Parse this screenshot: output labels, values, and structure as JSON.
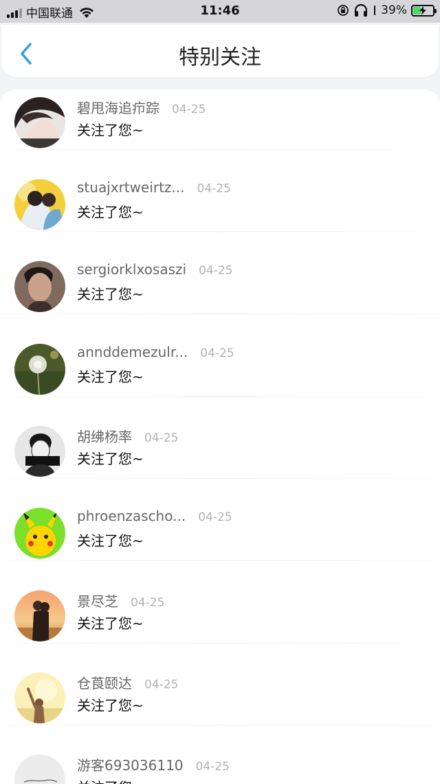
{
  "status_bar": {
    "carrier": "中国联通",
    "time": "11:46",
    "battery_percent": "39%",
    "battery_level": 0.39
  },
  "header": {
    "title": "特别关注"
  },
  "follows": [
    {
      "name": "碧甩海追疖踪",
      "date": "04-25",
      "message": "关注了您~"
    },
    {
      "name": "stuajxrtweirtz...",
      "date": "04-25",
      "message": "关注了您~"
    },
    {
      "name": "sergiorklxosaszi",
      "date": "04-25",
      "message": "关注了您~"
    },
    {
      "name": "annddemezulr...",
      "date": "04-25",
      "message": "关注了您~"
    },
    {
      "name": "胡绋杨率",
      "date": "04-25",
      "message": "关注了您~"
    },
    {
      "name": "phroenzascho...",
      "date": "04-25",
      "message": "关注了您~"
    },
    {
      "name": "景尽芝",
      "date": "04-25",
      "message": "关注了您~"
    },
    {
      "name": "仓莨颐达",
      "date": "04-25",
      "message": "关注了您~"
    },
    {
      "name": "游客693036110",
      "date": "04-25",
      "message": "关注了您~"
    }
  ],
  "colors": {
    "accent": "#2e9bea",
    "page_background": "#f3f4f6",
    "name_text": "#666666",
    "date_text": "#b2b2b2",
    "battery_charging": "#4cd964"
  },
  "icons": {
    "back": "chevron-left-icon",
    "wifi": "wifi-icon",
    "orientation_lock": "orientation-lock-icon",
    "headphones": "headphones-icon",
    "battery": "battery-charging-icon"
  }
}
